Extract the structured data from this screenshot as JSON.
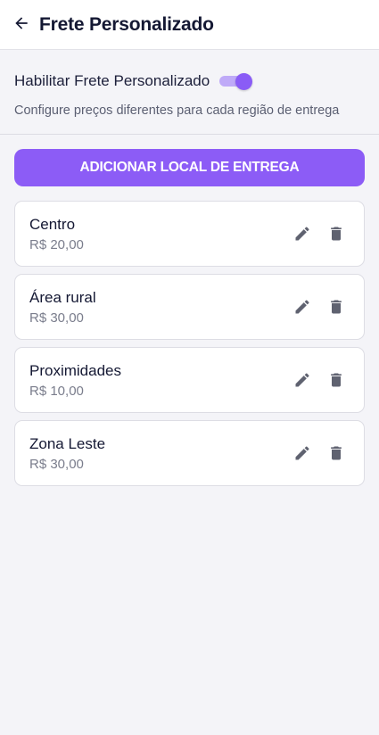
{
  "header": {
    "title": "Frete Personalizado",
    "back_icon": "arrow-left-icon"
  },
  "settings": {
    "toggle_label": "Habilitar Frete Personalizado",
    "toggle_enabled": true,
    "description": "Configure preços diferentes para cada região de entrega"
  },
  "add_button": {
    "label": "ADICIONAR LOCAL DE ENTREGA"
  },
  "locations": [
    {
      "name": "Centro",
      "price": "R$ 20,00"
    },
    {
      "name": "Área rural",
      "price": "R$ 30,00"
    },
    {
      "name": "Proximidades",
      "price": "R$ 10,00"
    },
    {
      "name": "Zona Leste",
      "price": "R$ 30,00"
    }
  ],
  "icons": {
    "edit": "pencil-icon",
    "delete": "trash-icon"
  },
  "colors": {
    "accent": "#8c5cf6",
    "toggle_track": "#bfaaf8",
    "background": "#f4f4f8",
    "card": "#ffffff",
    "icon": "#5f6270"
  }
}
